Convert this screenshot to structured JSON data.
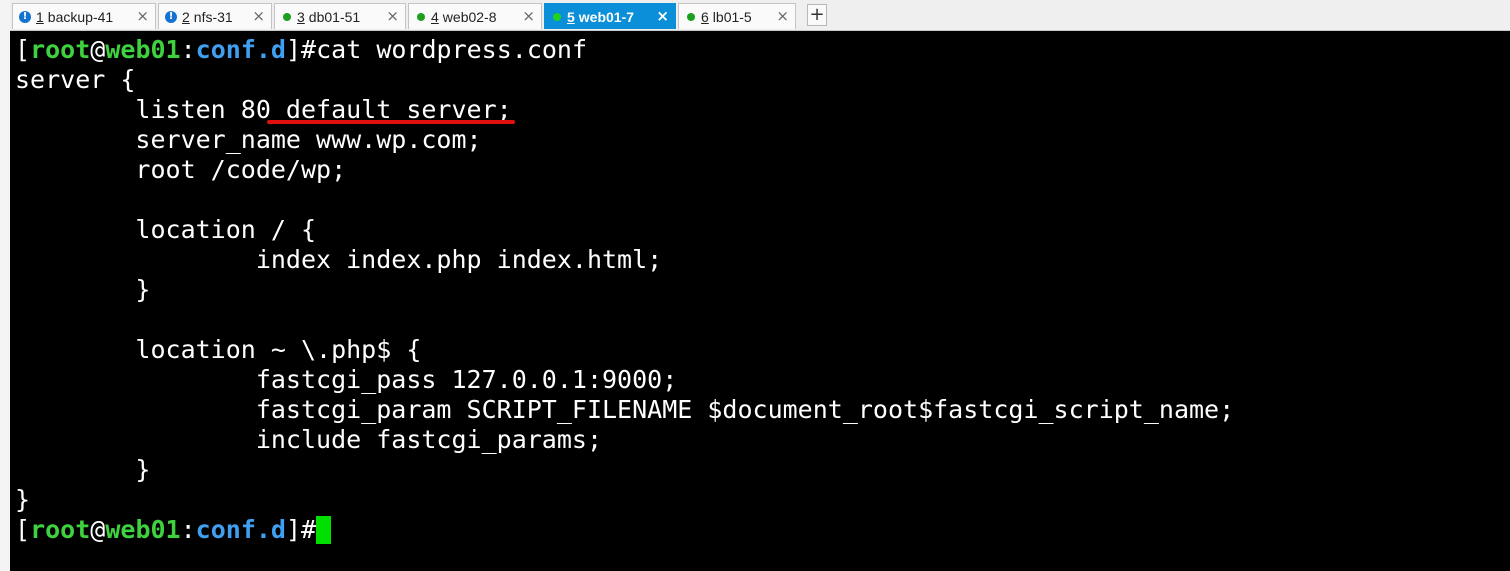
{
  "tabs": [
    {
      "num": "1",
      "label": "backup-41",
      "status": "warning",
      "active": false
    },
    {
      "num": "2",
      "label": "nfs-31",
      "status": "warning",
      "active": false
    },
    {
      "num": "3",
      "label": "db01-51",
      "status": "connected",
      "active": false
    },
    {
      "num": "4",
      "label": "web02-8",
      "status": "connected",
      "active": false
    },
    {
      "num": "5",
      "label": "web01-7",
      "status": "connected",
      "active": true
    },
    {
      "num": "6",
      "label": "lb01-5",
      "status": "connected",
      "active": false
    }
  ],
  "tab_close_glyph": "×",
  "add_tab_glyph": "+",
  "prompt": {
    "open": "[",
    "user": "root",
    "at": "@",
    "host": "web01",
    "colon": ":",
    "dir": "conf.d",
    "close": "]",
    "sym": "#"
  },
  "command": "cat wordpress.conf",
  "output": [
    "server {",
    "        listen 80 default_server;",
    "        server_name www.wp.com;",
    "        root /code/wp;",
    "",
    "        location / {",
    "                index index.php index.html;",
    "        }",
    "",
    "        location ~ \\.php$ {",
    "                fastcgi_pass 127.0.0.1:9000;",
    "                fastcgi_param SCRIPT_FILENAME $document_root$fastcgi_script_name;",
    "                include fastcgi_params;",
    "        }",
    "}"
  ],
  "colors": {
    "active_tab": "#0a8fd8",
    "prompt_user_host": "#3fd23f",
    "prompt_dir": "#3f9ff0",
    "cursor": "#00e000",
    "annotation": "#e01010",
    "terminal_bg": "#000000"
  }
}
